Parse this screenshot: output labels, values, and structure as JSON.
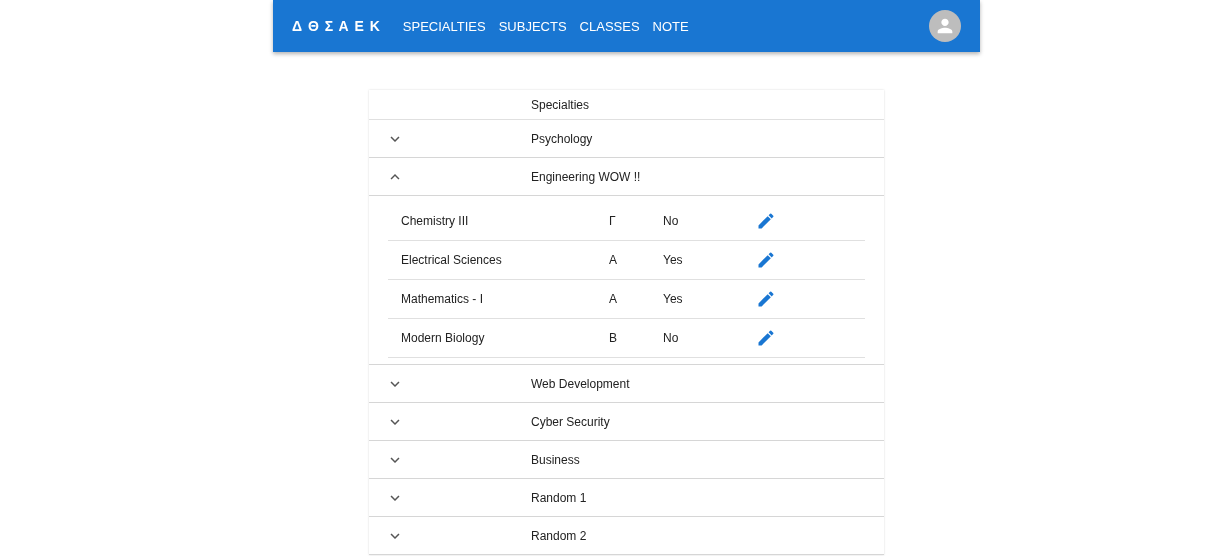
{
  "app_bar": {
    "logo": "Δ Θ Σ Α Ε Κ",
    "nav": [
      {
        "label": "SPECIALTIES"
      },
      {
        "label": "SUBJECTS"
      },
      {
        "label": "CLASSES"
      },
      {
        "label": "NOTE"
      }
    ]
  },
  "table": {
    "heading": "Specialties",
    "specialties": [
      {
        "name": "Psychology",
        "expanded": false
      },
      {
        "name": "Engineering WOW !!",
        "expanded": true,
        "subjects": [
          {
            "name": "Chemistry III",
            "class": "Γ",
            "column_3": "No"
          },
          {
            "name": "Electrical Sciences",
            "class": "A",
            "column_3": "Yes"
          },
          {
            "name": "Mathematics - I",
            "class": "A",
            "column_3": "Yes"
          },
          {
            "name": "Modern Biology",
            "class": "B",
            "column_3": "No"
          }
        ]
      },
      {
        "name": "Web Development",
        "expanded": false
      },
      {
        "name": "Cyber Security",
        "expanded": false
      },
      {
        "name": "Business",
        "expanded": false
      },
      {
        "name": "Random 1",
        "expanded": false
      },
      {
        "name": "Random 2",
        "expanded": false
      }
    ]
  }
}
